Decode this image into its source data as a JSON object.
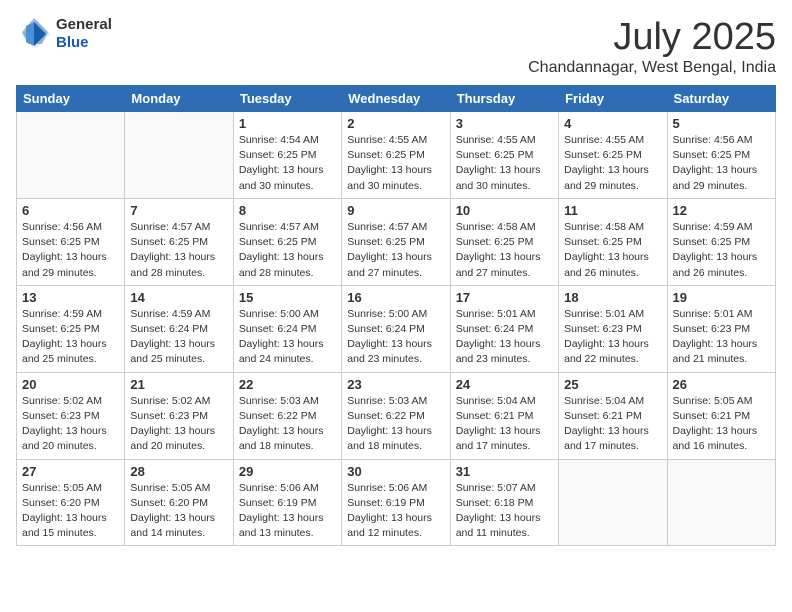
{
  "header": {
    "logo_general": "General",
    "logo_blue": "Blue",
    "month": "July 2025",
    "location": "Chandannagar, West Bengal, India"
  },
  "weekdays": [
    "Sunday",
    "Monday",
    "Tuesday",
    "Wednesday",
    "Thursday",
    "Friday",
    "Saturday"
  ],
  "weeks": [
    [
      {
        "day": "",
        "sunrise": "",
        "sunset": "",
        "daylight": ""
      },
      {
        "day": "",
        "sunrise": "",
        "sunset": "",
        "daylight": ""
      },
      {
        "day": "1",
        "sunrise": "Sunrise: 4:54 AM",
        "sunset": "Sunset: 6:25 PM",
        "daylight": "Daylight: 13 hours and 30 minutes."
      },
      {
        "day": "2",
        "sunrise": "Sunrise: 4:55 AM",
        "sunset": "Sunset: 6:25 PM",
        "daylight": "Daylight: 13 hours and 30 minutes."
      },
      {
        "day": "3",
        "sunrise": "Sunrise: 4:55 AM",
        "sunset": "Sunset: 6:25 PM",
        "daylight": "Daylight: 13 hours and 30 minutes."
      },
      {
        "day": "4",
        "sunrise": "Sunrise: 4:55 AM",
        "sunset": "Sunset: 6:25 PM",
        "daylight": "Daylight: 13 hours and 29 minutes."
      },
      {
        "day": "5",
        "sunrise": "Sunrise: 4:56 AM",
        "sunset": "Sunset: 6:25 PM",
        "daylight": "Daylight: 13 hours and 29 minutes."
      }
    ],
    [
      {
        "day": "6",
        "sunrise": "Sunrise: 4:56 AM",
        "sunset": "Sunset: 6:25 PM",
        "daylight": "Daylight: 13 hours and 29 minutes."
      },
      {
        "day": "7",
        "sunrise": "Sunrise: 4:57 AM",
        "sunset": "Sunset: 6:25 PM",
        "daylight": "Daylight: 13 hours and 28 minutes."
      },
      {
        "day": "8",
        "sunrise": "Sunrise: 4:57 AM",
        "sunset": "Sunset: 6:25 PM",
        "daylight": "Daylight: 13 hours and 28 minutes."
      },
      {
        "day": "9",
        "sunrise": "Sunrise: 4:57 AM",
        "sunset": "Sunset: 6:25 PM",
        "daylight": "Daylight: 13 hours and 27 minutes."
      },
      {
        "day": "10",
        "sunrise": "Sunrise: 4:58 AM",
        "sunset": "Sunset: 6:25 PM",
        "daylight": "Daylight: 13 hours and 27 minutes."
      },
      {
        "day": "11",
        "sunrise": "Sunrise: 4:58 AM",
        "sunset": "Sunset: 6:25 PM",
        "daylight": "Daylight: 13 hours and 26 minutes."
      },
      {
        "day": "12",
        "sunrise": "Sunrise: 4:59 AM",
        "sunset": "Sunset: 6:25 PM",
        "daylight": "Daylight: 13 hours and 26 minutes."
      }
    ],
    [
      {
        "day": "13",
        "sunrise": "Sunrise: 4:59 AM",
        "sunset": "Sunset: 6:25 PM",
        "daylight": "Daylight: 13 hours and 25 minutes."
      },
      {
        "day": "14",
        "sunrise": "Sunrise: 4:59 AM",
        "sunset": "Sunset: 6:24 PM",
        "daylight": "Daylight: 13 hours and 25 minutes."
      },
      {
        "day": "15",
        "sunrise": "Sunrise: 5:00 AM",
        "sunset": "Sunset: 6:24 PM",
        "daylight": "Daylight: 13 hours and 24 minutes."
      },
      {
        "day": "16",
        "sunrise": "Sunrise: 5:00 AM",
        "sunset": "Sunset: 6:24 PM",
        "daylight": "Daylight: 13 hours and 23 minutes."
      },
      {
        "day": "17",
        "sunrise": "Sunrise: 5:01 AM",
        "sunset": "Sunset: 6:24 PM",
        "daylight": "Daylight: 13 hours and 23 minutes."
      },
      {
        "day": "18",
        "sunrise": "Sunrise: 5:01 AM",
        "sunset": "Sunset: 6:23 PM",
        "daylight": "Daylight: 13 hours and 22 minutes."
      },
      {
        "day": "19",
        "sunrise": "Sunrise: 5:01 AM",
        "sunset": "Sunset: 6:23 PM",
        "daylight": "Daylight: 13 hours and 21 minutes."
      }
    ],
    [
      {
        "day": "20",
        "sunrise": "Sunrise: 5:02 AM",
        "sunset": "Sunset: 6:23 PM",
        "daylight": "Daylight: 13 hours and 20 minutes."
      },
      {
        "day": "21",
        "sunrise": "Sunrise: 5:02 AM",
        "sunset": "Sunset: 6:23 PM",
        "daylight": "Daylight: 13 hours and 20 minutes."
      },
      {
        "day": "22",
        "sunrise": "Sunrise: 5:03 AM",
        "sunset": "Sunset: 6:22 PM",
        "daylight": "Daylight: 13 hours and 18 minutes."
      },
      {
        "day": "23",
        "sunrise": "Sunrise: 5:03 AM",
        "sunset": "Sunset: 6:22 PM",
        "daylight": "Daylight: 13 hours and 18 minutes."
      },
      {
        "day": "24",
        "sunrise": "Sunrise: 5:04 AM",
        "sunset": "Sunset: 6:21 PM",
        "daylight": "Daylight: 13 hours and 17 minutes."
      },
      {
        "day": "25",
        "sunrise": "Sunrise: 5:04 AM",
        "sunset": "Sunset: 6:21 PM",
        "daylight": "Daylight: 13 hours and 17 minutes."
      },
      {
        "day": "26",
        "sunrise": "Sunrise: 5:05 AM",
        "sunset": "Sunset: 6:21 PM",
        "daylight": "Daylight: 13 hours and 16 minutes."
      }
    ],
    [
      {
        "day": "27",
        "sunrise": "Sunrise: 5:05 AM",
        "sunset": "Sunset: 6:20 PM",
        "daylight": "Daylight: 13 hours and 15 minutes."
      },
      {
        "day": "28",
        "sunrise": "Sunrise: 5:05 AM",
        "sunset": "Sunset: 6:20 PM",
        "daylight": "Daylight: 13 hours and 14 minutes."
      },
      {
        "day": "29",
        "sunrise": "Sunrise: 5:06 AM",
        "sunset": "Sunset: 6:19 PM",
        "daylight": "Daylight: 13 hours and 13 minutes."
      },
      {
        "day": "30",
        "sunrise": "Sunrise: 5:06 AM",
        "sunset": "Sunset: 6:19 PM",
        "daylight": "Daylight: 13 hours and 12 minutes."
      },
      {
        "day": "31",
        "sunrise": "Sunrise: 5:07 AM",
        "sunset": "Sunset: 6:18 PM",
        "daylight": "Daylight: 13 hours and 11 minutes."
      },
      {
        "day": "",
        "sunrise": "",
        "sunset": "",
        "daylight": ""
      },
      {
        "day": "",
        "sunrise": "",
        "sunset": "",
        "daylight": ""
      }
    ]
  ]
}
